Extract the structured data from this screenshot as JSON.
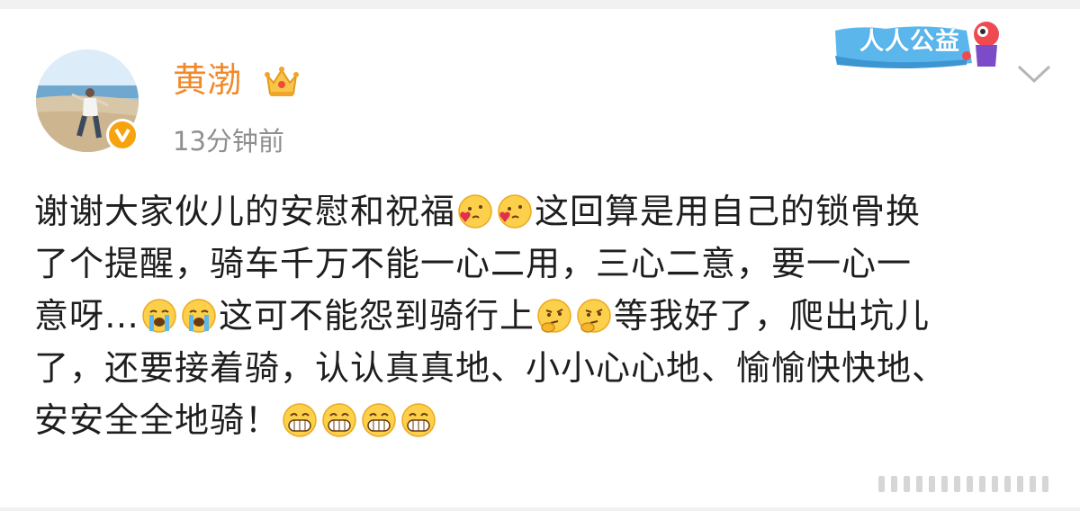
{
  "post": {
    "author": {
      "name": "黄渤",
      "avatar_icon": "avatar-photo",
      "badge_icon": "verified-v-icon",
      "crown_icon": "crown-icon",
      "time": "13分钟前"
    },
    "campaign_badge": {
      "label": "人人公益",
      "icon": "mascot-icon",
      "color": "#4aa7e0"
    },
    "menu_icon": "chevron-down-icon",
    "lines": [
      {
        "t1": "谢谢大家伙儿的安慰和祝福",
        "t2": "这回算是用自己的锁骨换"
      },
      {
        "t1": "了个提醒，骑车千万不能一心二用，三心二意，要一心一"
      },
      {
        "t1": "意呀…",
        "t2": "这可不能怨到骑行上",
        "t3": "等我好了，爬出坑儿"
      },
      {
        "t1": "了，还要接着骑，认认真真地、小小心心地、愉愉快快地、"
      },
      {
        "t1": "安安全全地骑！"
      }
    ],
    "emoji_names": [
      "love-emoji",
      "cry-emoji",
      "think-emoji",
      "grin-emoji"
    ],
    "colors": {
      "name": "#f0892a",
      "time": "#8f8f8f",
      "text": "#1e1e1e",
      "badge": "#f7a30d"
    }
  }
}
